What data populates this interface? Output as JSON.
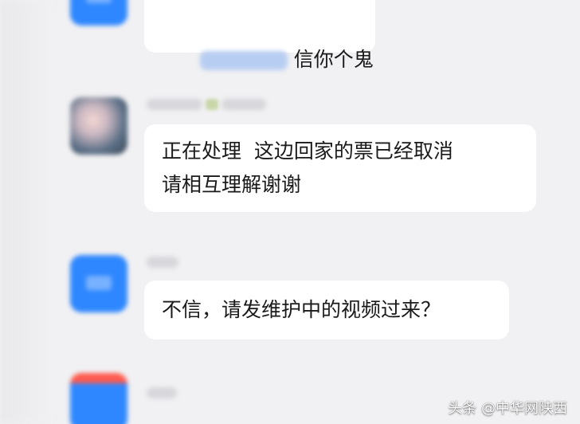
{
  "messages": [
    {
      "text": "信你个鬼"
    },
    {
      "text": "正在处理  这边回家的票已经取消\n请相互理解谢谢"
    },
    {
      "text": "不信，请发维护中的视频过来？"
    }
  ],
  "watermark": "头条 @中华网陕西",
  "colors": {
    "background": "#f1f1f3",
    "bubble": "#ffffff",
    "avatar_blue": "#2f87ff",
    "text": "#1a1a1a"
  }
}
